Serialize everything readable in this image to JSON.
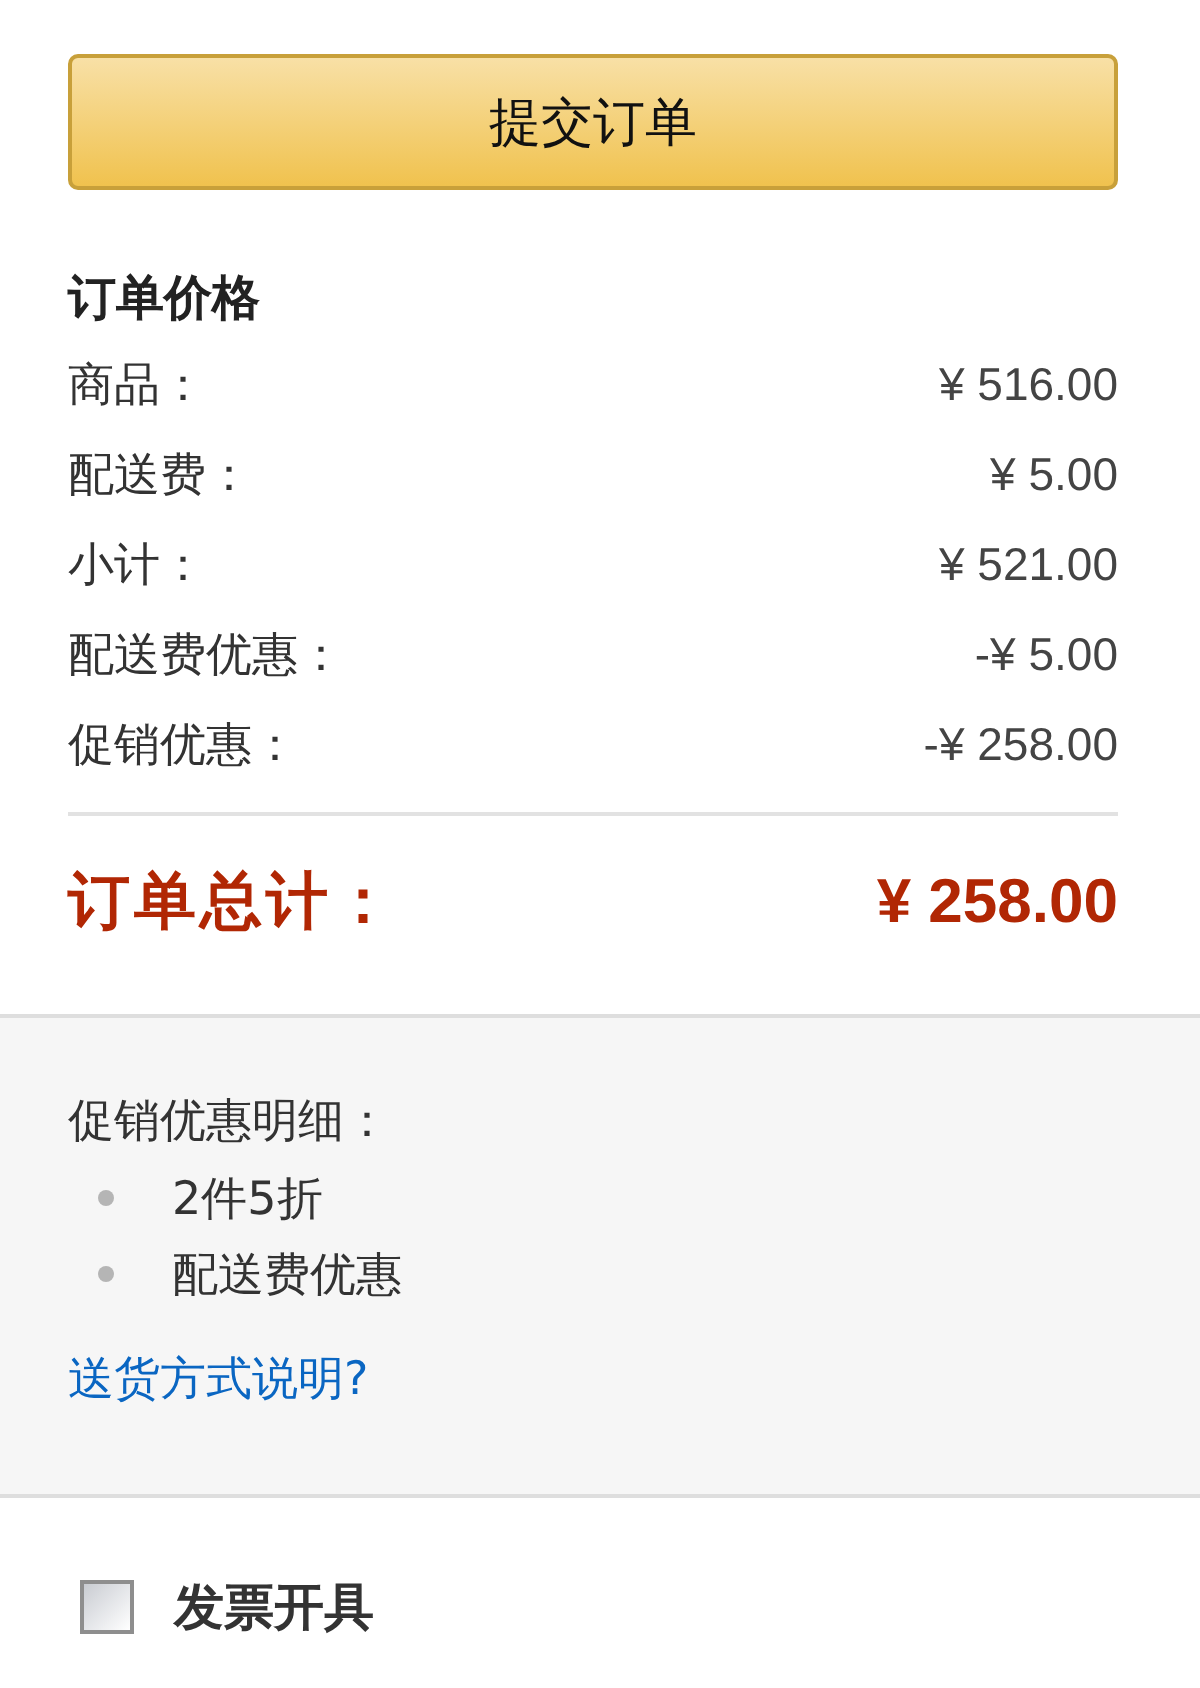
{
  "submit_button": {
    "label": "提交订单"
  },
  "order_price": {
    "title": "订单价格",
    "rows": [
      {
        "label": "商品：",
        "value": "¥ 516.00"
      },
      {
        "label": "配送费：",
        "value": "¥ 5.00"
      },
      {
        "label": "小计：",
        "value": "¥ 521.00"
      },
      {
        "label": "配送费优惠：",
        "value": "-¥ 5.00"
      },
      {
        "label": "促销优惠：",
        "value": "-¥ 258.00"
      }
    ],
    "total": {
      "label": "订单总计：",
      "value": "¥ 258.00"
    }
  },
  "promotion_details": {
    "title": "促销优惠明细：",
    "items": [
      "2件5折",
      "配送费优惠"
    ],
    "link": "送货方式说明?"
  },
  "invoice": {
    "label": "发票开具",
    "checked": false
  }
}
